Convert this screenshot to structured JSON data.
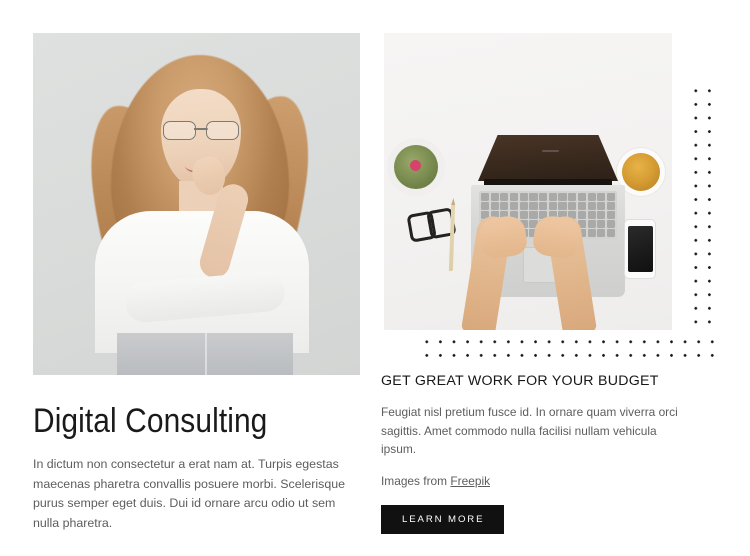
{
  "left_column": {
    "photo": {
      "alt": "young woman with glasses smiling, light gray studio background"
    },
    "heading": "Digital Consulting",
    "paragraph": "In dictum non consectetur a erat nam at. Turpis egestas maecenas pharetra convallis posuere morbi. Scelerisque purus semper eget duis. Dui id ornare arcu odio ut sem nulla pharetra."
  },
  "right_column": {
    "photo": {
      "alt": "top down view of hands typing on a laptop with glasses, pencil, phone, coffee and a cactus"
    },
    "heading": "GET GREAT WORK FOR YOUR BUDGET",
    "paragraph": "Feugiat nisl pretium fusce id. In ornare quam viverra orci sagittis. Amet commodo nulla facilisi nullam vehicula ipsum.",
    "credit_prefix": "Images from ",
    "credit_link": "Freepik",
    "cta_label": "LEARN MORE"
  },
  "decor": {
    "dot_column_label": "vertical dotted pattern",
    "dot_band_label": "horizontal dotted pattern"
  },
  "colors": {
    "page_background": "#ffffff",
    "heading": "#1a1a1a",
    "body_text": "#5d5d5d",
    "button_background": "#111111",
    "button_text": "#ffffff",
    "dot": "#1c1c1c"
  }
}
